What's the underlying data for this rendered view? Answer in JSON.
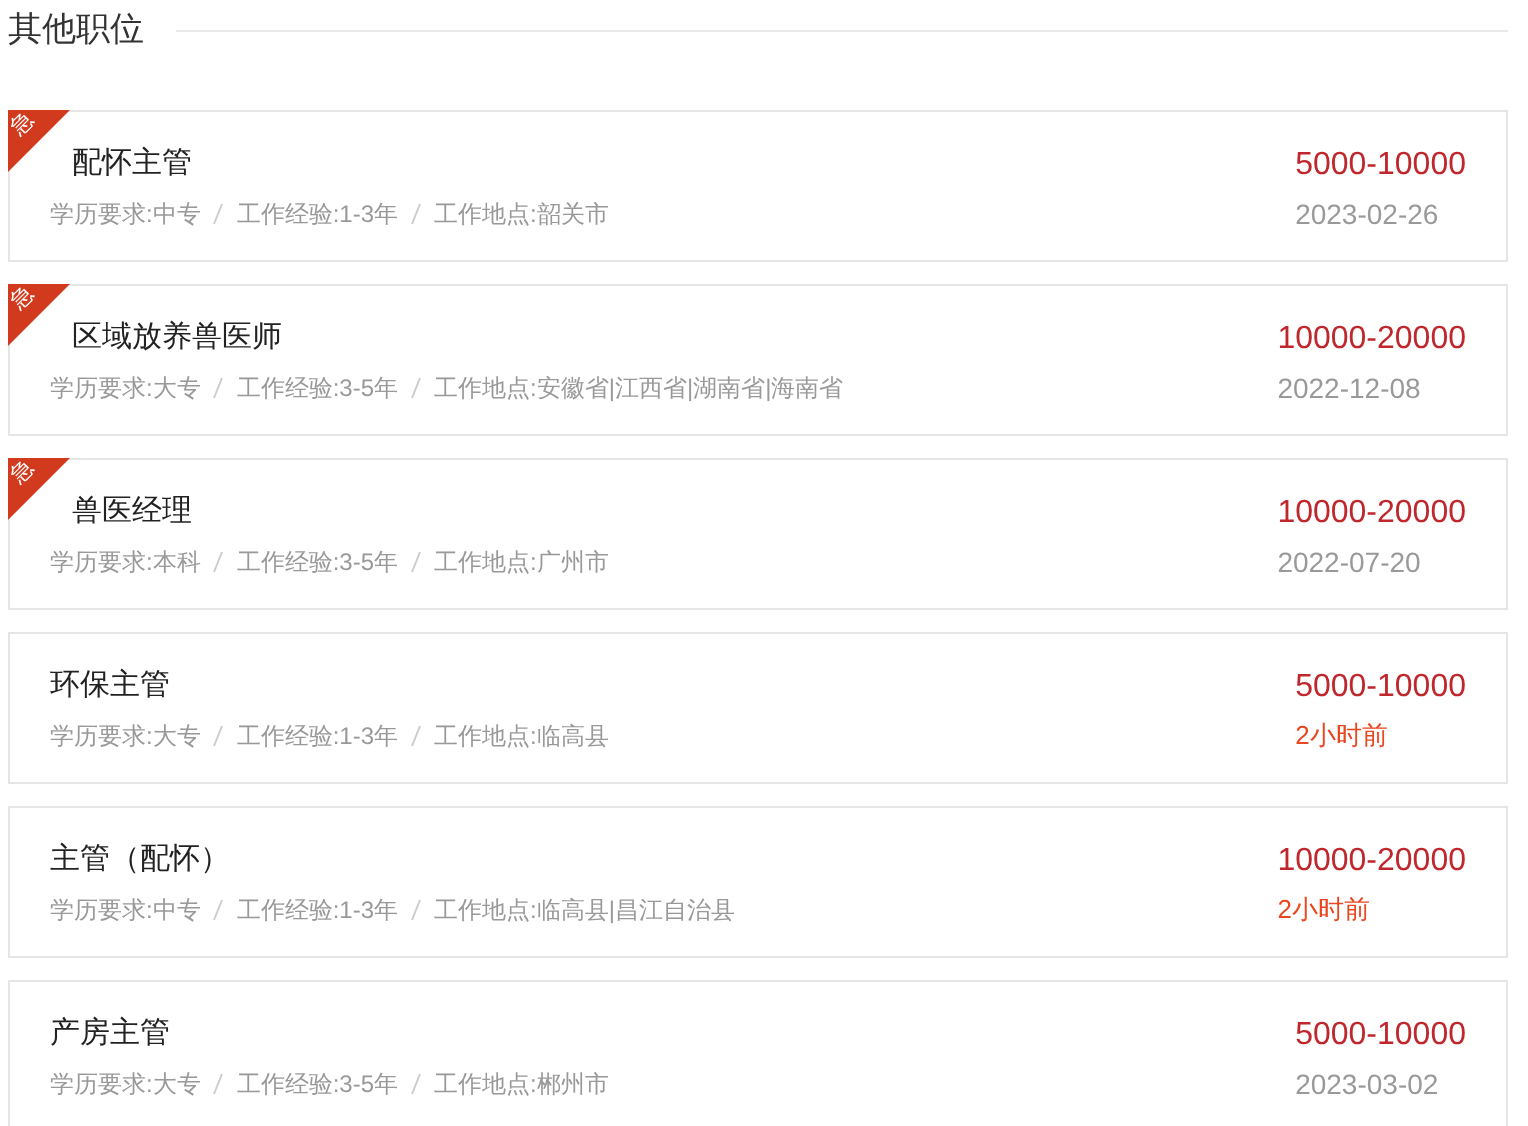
{
  "section_title": "其他职位",
  "jobs": [
    {
      "title": "配怀主管",
      "urgent": true,
      "meta": [
        "学历要求:中专",
        "工作经验:1-3年",
        "工作地点:韶关市"
      ],
      "salary": "5000-10000",
      "time": "2023-02-26",
      "recent": false,
      "badge": "急"
    },
    {
      "title": "区域放养兽医师",
      "urgent": true,
      "meta": [
        "学历要求:大专",
        "工作经验:3-5年",
        "工作地点:安徽省|江西省|湖南省|海南省"
      ],
      "salary": "10000-20000",
      "time": "2022-12-08",
      "recent": false,
      "badge": "急"
    },
    {
      "title": "兽医经理",
      "urgent": true,
      "meta": [
        "学历要求:本科",
        "工作经验:3-5年",
        "工作地点:广州市"
      ],
      "salary": "10000-20000",
      "time": "2022-07-20",
      "recent": false,
      "badge": "急"
    },
    {
      "title": "环保主管",
      "urgent": false,
      "meta": [
        "学历要求:大专",
        "工作经验:1-3年",
        "工作地点:临高县"
      ],
      "salary": "5000-10000",
      "time": "2小时前",
      "recent": true
    },
    {
      "title": "主管（配怀）",
      "urgent": false,
      "meta": [
        "学历要求:中专",
        "工作经验:1-3年",
        "工作地点:临高县|昌江自治县"
      ],
      "salary": "10000-20000",
      "time": "2小时前",
      "recent": true
    },
    {
      "title": "产房主管",
      "urgent": false,
      "meta": [
        "学历要求:大专",
        "工作经验:3-5年",
        "工作地点:郴州市"
      ],
      "salary": "5000-10000",
      "time": "2023-03-02",
      "recent": false
    }
  ]
}
